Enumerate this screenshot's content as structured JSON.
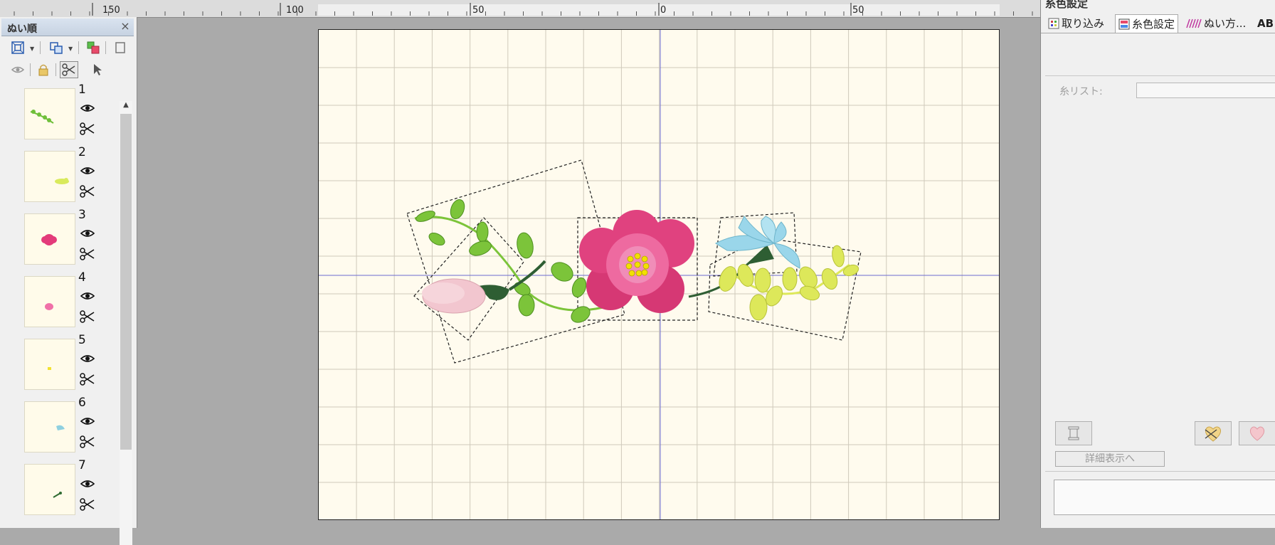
{
  "ruler": {
    "labels": [
      {
        "text": "150",
        "bind_key": "r150"
      },
      {
        "text": "100",
        "bind_key": "r100"
      },
      {
        "text": "50",
        "bind_key": "rm50"
      },
      {
        "text": "0",
        "bind_key": "r0"
      },
      {
        "text": "50",
        "bind_key": "rp50"
      }
    ]
  },
  "sew_order_panel": {
    "title": "ぬい順",
    "close_glyph": "×",
    "toolbar_row1": [
      "fit-view-icon",
      "group-icon",
      "order-icon",
      "frame-icon"
    ],
    "toolbar_row2": [
      "eye-toggle-icon",
      "lock-icon",
      "scissors-toggle-icon",
      "pointer-icon"
    ],
    "items": [
      {
        "num": "1",
        "thumb_color": "#6fbf3a",
        "thumb_shape": "sprig"
      },
      {
        "num": "2",
        "thumb_color": "#d9ea5c",
        "thumb_shape": "leafgroup"
      },
      {
        "num": "3",
        "thumb_color": "#e33b7a",
        "thumb_shape": "flower"
      },
      {
        "num": "4",
        "thumb_color": "#f070a8",
        "thumb_shape": "blob"
      },
      {
        "num": "5",
        "thumb_color": "#f2e230",
        "thumb_shape": "dot"
      },
      {
        "num": "6",
        "thumb_color": "#8fd0e0",
        "thumb_shape": "bell"
      },
      {
        "num": "7",
        "thumb_color": "#2f6b32",
        "thumb_shape": "stem"
      }
    ]
  },
  "right_panel": {
    "title": "糸色設定",
    "tabs": [
      {
        "label": "取り込み",
        "icon": "import-icon"
      },
      {
        "label": "糸色設定",
        "icon": "thread-color-icon"
      },
      {
        "label": "ぬい方...",
        "icon": "stitch-type-icon"
      },
      {
        "label": "AB",
        "icon": "text-icon"
      }
    ],
    "thread_list_label": "糸リスト:",
    "detail_button": "詳細表示へ"
  },
  "colors": {
    "leaf_green": "#7cc43a",
    "dark_green": "#2e5e33",
    "pink_flower": "#e0427f",
    "light_pink": "#f2c6cf",
    "blue_flower": "#9ad6ea",
    "yellow_leaf": "#dde85a",
    "center_yellow": "#f2e000",
    "grid": "#cfcabb",
    "axis": "#6b6bd0"
  }
}
